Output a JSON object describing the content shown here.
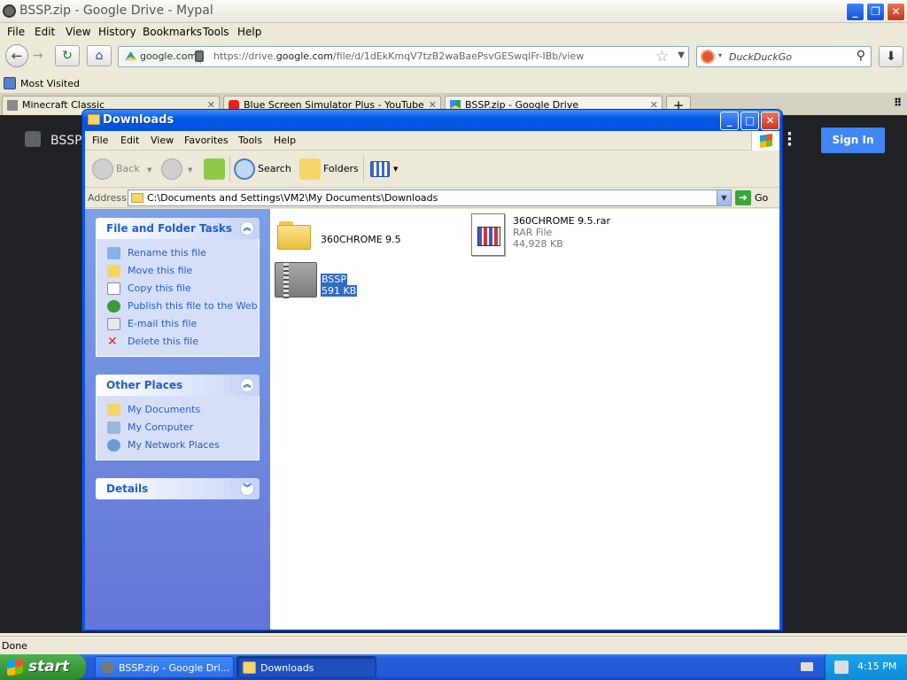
{
  "browser": {
    "title": "BSSP.zip - Google Drive - Mypal",
    "menu": [
      "File",
      "Edit",
      "View",
      "History",
      "Bookmarks",
      "Tools",
      "Help"
    ],
    "url_site": "google.com",
    "url_prefix": "https://drive.",
    "url_domain": "google.com",
    "url_path": "/file/d/1dEkKmqV7tzB2waBaePsvGESwqlFr-IBb/view",
    "search_placeholder": "DuckDuckGo",
    "bookmark": "Most Visited",
    "tabs": [
      {
        "label": "Minecraft Classic"
      },
      {
        "label": "Blue Screen Simulator Plus - YouTube"
      },
      {
        "label": "BSSP.zip - Google Drive"
      }
    ],
    "status": "Done"
  },
  "drive": {
    "file_name": "BSSP.",
    "sign_in": "Sign In"
  },
  "explorer": {
    "title": "Downloads",
    "menu": [
      "File",
      "Edit",
      "View",
      "Favorites",
      "Tools",
      "Help"
    ],
    "toolbar": {
      "back": "Back",
      "search": "Search",
      "folders": "Folders"
    },
    "address_label": "Address",
    "address_path": "C:\\Documents and Settings\\VM2\\My Documents\\Downloads",
    "go": "Go",
    "tasks": {
      "header": "File and Folder Tasks",
      "items": [
        "Rename this file",
        "Move this file",
        "Copy this file",
        "Publish this file to the Web",
        "E-mail this file",
        "Delete this file"
      ]
    },
    "places": {
      "header": "Other Places",
      "items": [
        "My Documents",
        "My Computer",
        "My Network Places"
      ]
    },
    "details": {
      "header": "Details"
    },
    "files": [
      {
        "name": "360CHROME 9.5"
      },
      {
        "name": "360CHROME 9.5.rar",
        "type": "RAR File",
        "size": "44,928 KB"
      },
      {
        "name": "BSSP",
        "size": "591 KB"
      }
    ]
  },
  "taskbar": {
    "start": "start",
    "tasks": [
      "BSSP.zip - Google Dri...",
      "Downloads"
    ],
    "clock": "4:15 PM"
  }
}
